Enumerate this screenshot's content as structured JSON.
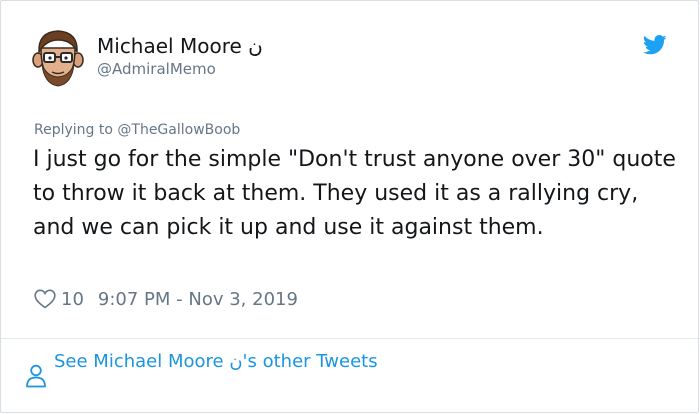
{
  "author": {
    "display_name": "Michael Moore ن",
    "handle": "@AdmiralMemo"
  },
  "reply": {
    "prefix": "Replying to",
    "mention": "@TheGallowBoob"
  },
  "tweet": {
    "text": "I just go for the simple \"Don't trust anyone over 30\" quote to throw it back at them. They used it as a rallying cry, and we can pick it up and use it against them."
  },
  "meta": {
    "likes": "10",
    "timestamp": "9:07 PM - Nov 3, 2019"
  },
  "footer": {
    "link_text": "See Michael Moore ن's other Tweets"
  },
  "icons": {
    "logo": "twitter-bird-icon",
    "like": "heart-icon",
    "profile": "person-icon"
  },
  "colors": {
    "brand_blue": "#1da1f2",
    "link_blue": "#1b95e0",
    "secondary_text": "#657786",
    "primary_text": "#14171a"
  }
}
